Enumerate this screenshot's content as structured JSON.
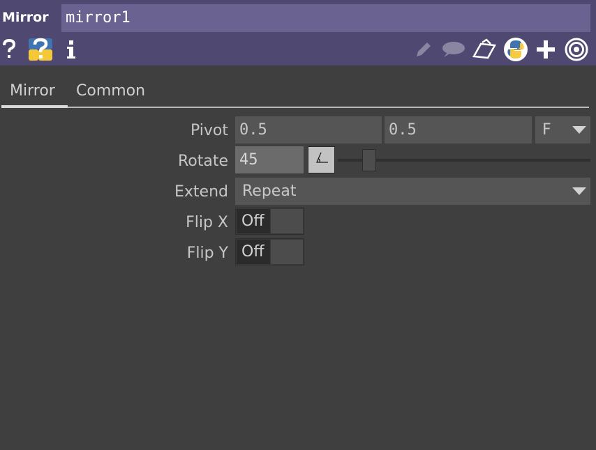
{
  "header": {
    "op_type": "Mirror",
    "op_name": "mirror1",
    "icons": {
      "help": "question-mark-icon",
      "python_help": "python-help-icon",
      "info": "info-icon",
      "edit": "pencil-icon",
      "comment": "comment-bubble-icon",
      "clipboard": "clipboard-icon",
      "python": "python-icon",
      "add": "plus-icon",
      "target": "target-icon"
    }
  },
  "tabs": [
    {
      "label": "Mirror",
      "active": true
    },
    {
      "label": "Common",
      "active": false
    }
  ],
  "params": {
    "pivot": {
      "label": "Pivot",
      "x": "0.5",
      "y": "0.5",
      "unit": "F"
    },
    "rotate": {
      "label": "Rotate",
      "value": "45",
      "slider_fraction": 0.125
    },
    "extend": {
      "label": "Extend",
      "value": "Repeat"
    },
    "flipx": {
      "label": "Flip X",
      "value": "Off"
    },
    "flipy": {
      "label": "Flip Y",
      "value": "Off"
    }
  },
  "colors": {
    "header_bg": "#4f4870",
    "name_field_bg": "#6a6290",
    "panel_bg": "#3f3f3f"
  }
}
